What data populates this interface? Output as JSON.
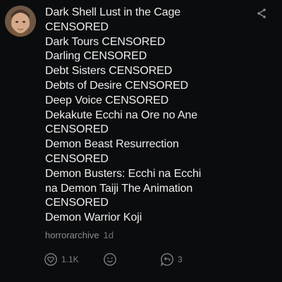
{
  "post": {
    "lines": [
      "Dark Shell Lust in the Cage",
      "CENSORED",
      "Dark Tours CENSORED",
      "Darling CENSORED",
      "Debt Sisters CENSORED",
      "Debts of Desire CENSORED",
      "Deep Voice CENSORED",
      "Dekakute Ecchi na Ore no Ane",
      "CENSORED",
      "Demon Beast Resurrection",
      "CENSORED",
      "Demon Busters: Ecchi na Ecchi",
      "na Demon Taiji The Animation",
      "CENSORED",
      "Demon Warrior Koji"
    ],
    "author": "horrorarchive",
    "time": "1d",
    "like_count": "1.1K",
    "reply_count": "3"
  },
  "icons": {
    "avatar": "avatar-photo",
    "share": "share-icon",
    "like": "heart-icon",
    "react": "smiley-icon",
    "reply": "reply-bubble-icon"
  },
  "colors": {
    "background": "#0b0c0e",
    "text": "#ededed",
    "muted": "#8a8d92"
  }
}
